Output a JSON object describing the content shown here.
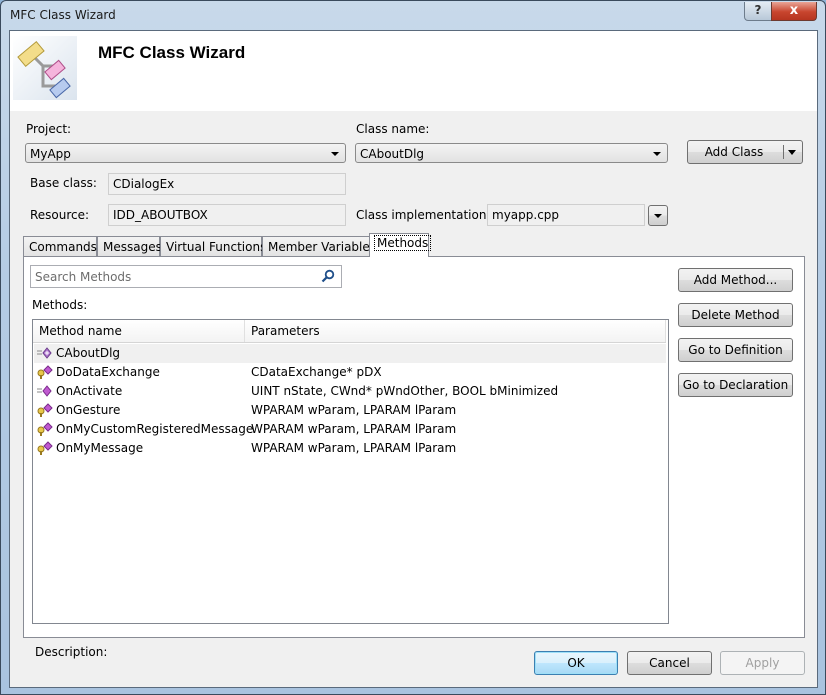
{
  "window": {
    "title": "MFC Class Wizard",
    "help_label": "?",
    "close_label": "x"
  },
  "banner": {
    "title": "MFC Class Wizard",
    "icon": "class-diagram-icon"
  },
  "form": {
    "project_label": "Project:",
    "project_value": "MyApp",
    "class_name_label": "Class name:",
    "class_name_value": "CAboutDlg",
    "add_class_label": "Add Class",
    "base_class_label": "Base class:",
    "base_class_value": "CDialogEx",
    "resource_label": "Resource:",
    "resource_value": "IDD_ABOUTBOX",
    "class_impl_label": "Class implementation:",
    "class_impl_value": "myapp.cpp"
  },
  "tabs": [
    {
      "label": "Commands",
      "active": false
    },
    {
      "label": "Messages",
      "active": false
    },
    {
      "label": "Virtual Functions",
      "active": false
    },
    {
      "label": "Member Variables",
      "active": false
    },
    {
      "label": "Methods",
      "active": true
    }
  ],
  "methods_panel": {
    "search_placeholder": "Search Methods",
    "methods_label": "Methods:",
    "columns": [
      "Method name",
      "Parameters"
    ],
    "rows": [
      {
        "icon": "constructor-method-icon",
        "name": "CAboutDlg",
        "params": "",
        "selected": true
      },
      {
        "icon": "protected-method-icon",
        "name": "DoDataExchange",
        "params": "CDataExchange* pDX"
      },
      {
        "icon": "public-method-icon",
        "name": "OnActivate",
        "params": "UINT nState, CWnd* pWndOther, BOOL bMinimized"
      },
      {
        "icon": "protected-method-icon",
        "name": "OnGesture",
        "params": "WPARAM wParam, LPARAM lParam"
      },
      {
        "icon": "protected-method-icon",
        "name": "OnMyCustomRegisteredMessage",
        "params": "WPARAM wParam, LPARAM lParam"
      },
      {
        "icon": "protected-method-icon",
        "name": "OnMyMessage",
        "params": "WPARAM wParam, LPARAM lParam"
      }
    ],
    "description_label": "Description:",
    "buttons": {
      "add_method": "Add Method...",
      "delete_method": "Delete Method",
      "go_to_definition": "Go to Definition",
      "go_to_declaration": "Go to Declaration"
    }
  },
  "footer": {
    "ok": "OK",
    "cancel": "Cancel",
    "apply": "Apply"
  }
}
